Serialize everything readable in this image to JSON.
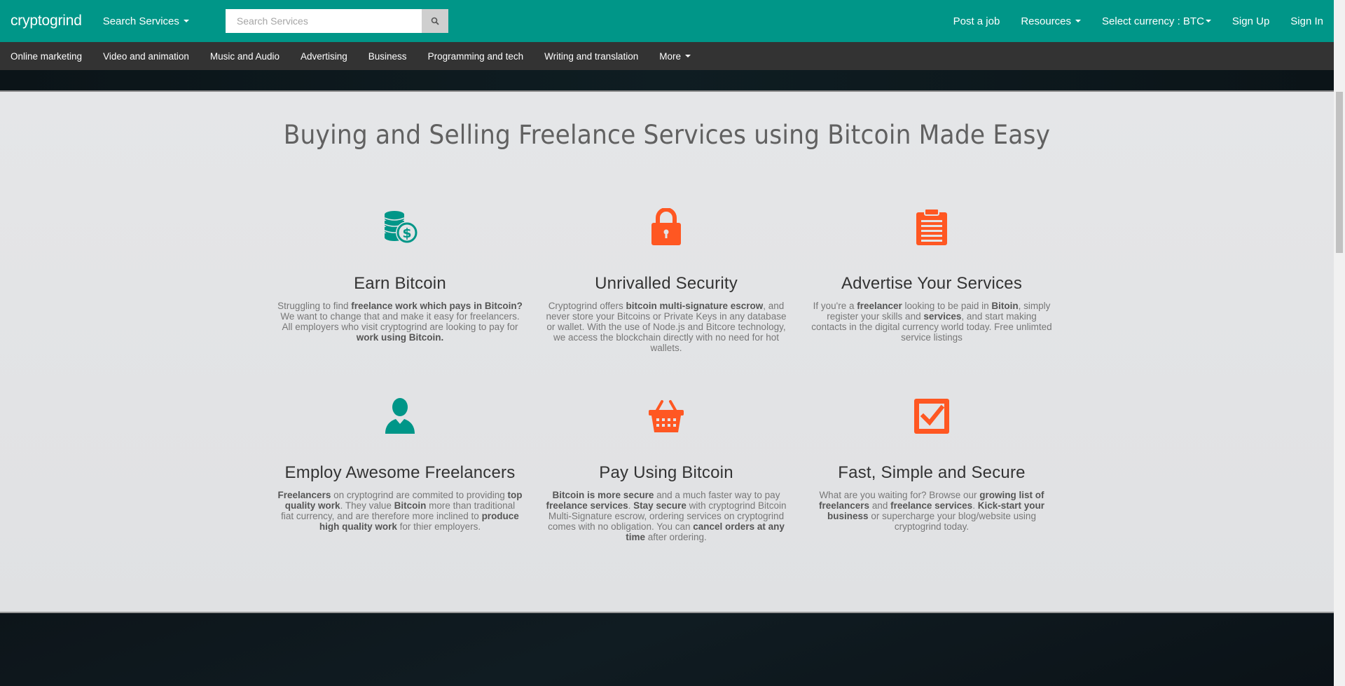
{
  "nav": {
    "brand": "cryptogrind",
    "search_services": "Search Services",
    "search_placeholder": "Search Services",
    "post_job": "Post a job",
    "resources": "Resources",
    "currency": "Select currency : BTC",
    "sign_up": "Sign Up",
    "sign_in": "Sign In"
  },
  "categories": [
    "Online marketing",
    "Video and animation",
    "Music and Audio",
    "Advertising",
    "Business",
    "Programming and tech",
    "Writing and translation",
    "More"
  ],
  "main": {
    "title": "Buying and Selling Freelance Services using Bitcoin Made Easy"
  },
  "features": [
    {
      "title": "Earn Bitcoin",
      "icon": "coins-dollar-icon",
      "html": "Struggling to find <b>freelance work which pays in Bitcoin?</b> We want to change that and make it easy for freelancers. All employers who visit cryptogrind are looking to pay for <b>work using Bitcoin.</b>"
    },
    {
      "title": "Unrivalled Security",
      "icon": "lock-icon",
      "html": "Cryptogrind offers <b>bitcoin multi-signature escrow</b>, and never store your Bitcoins or Private Keys in any database or wallet. With the use of Node.js and Bitcore technology, we access the blockchain directly with no need for hot wallets."
    },
    {
      "title": "Advertise Your Services",
      "icon": "clipboard-icon",
      "html": "If you're a <b>freelancer</b> looking to be paid in <b>Bitoin</b>, simply register your skills and <b>services</b>, and start making contacts in the digital currency world today. Free unlimted service listings"
    },
    {
      "title": "Employ Awesome Freelancers",
      "icon": "user-icon",
      "html": "<b>Freelancers</b> on cryptogrind are commited to providing <b>top quality work</b>. They value <b>Bitcoin</b> more than traditional fiat currency, and are therefore more inclined to <b>produce high quality work</b> for thier employers."
    },
    {
      "title": "Pay Using Bitcoin",
      "icon": "basket-icon",
      "html": "<b>Bitcoin is more secure</b> and a much faster way to pay <b>freelance services</b>. <b>Stay secure</b> with cryptogrind Bitcoin Multi-Signature escrow, ordering services on cryptogrind comes with no obligation. You can <b>cancel orders at any time</b> after ordering."
    },
    {
      "title": "Fast, Simple and Secure",
      "icon": "checkbox-icon",
      "html": "What are you waiting for? Browse our <b>growing list of freelancers</b> and <b>freelance services</b>. <b>Kick-start your business</b> or supercharge your blog/website using cryptogrind today."
    }
  ],
  "colors": {
    "teal": "#009688",
    "orange": "#ff5722",
    "dark_bar": "#333333"
  }
}
